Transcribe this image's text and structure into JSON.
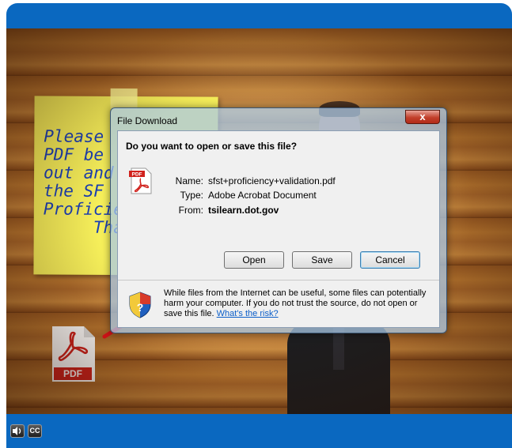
{
  "sticky_note": {
    "text": "Please\nPDF be\nout and\nthe SF\nProficie\n     Tha"
  },
  "pdf_icon": {
    "label": "PDF"
  },
  "dialog": {
    "title": "File Download",
    "close_label": "x",
    "question": "Do you want to open or save this file?",
    "name_label": "Name:",
    "name_value": "sfst+proficiency+validation.pdf",
    "type_label": "Type:",
    "type_value": "Adobe Acrobat Document",
    "from_label": "From:",
    "from_value": "tsilearn.dot.gov",
    "file_icon_label": "PDF",
    "open_label": "Open",
    "save_label": "Save",
    "cancel_label": "Cancel",
    "warning_text": "While files from the Internet can be useful, some files can potentially harm your computer. If you do not trust the source, do not open or save this file.",
    "risk_link": "What's the risk?"
  },
  "controls": {
    "cc_label": "CC"
  },
  "colors": {
    "frame": "#0a68c0",
    "sticky": "#f6ef5a",
    "handwriting": "#1a3fb5",
    "arrow": "#e8141b",
    "pdf_red": "#d0211c",
    "link": "#0b5ec9"
  },
  "icons": [
    "volume-icon",
    "cc-icon",
    "shield-icon",
    "pdf-file-icon",
    "close-icon",
    "arrow-annotation"
  ]
}
